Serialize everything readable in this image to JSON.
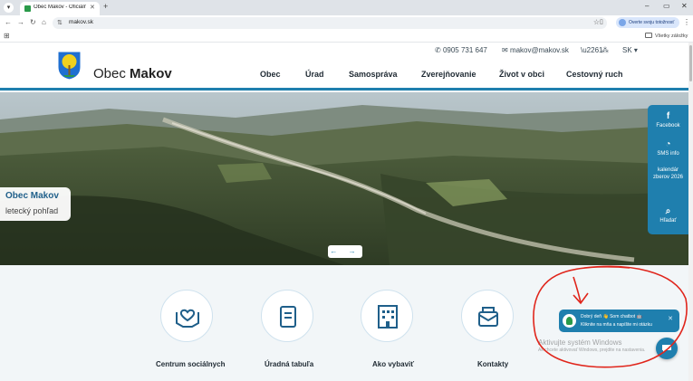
{
  "browser": {
    "tab_title": "Obec Makov - Oficiálna stránk",
    "tab_close": "✕",
    "new_tab": "+",
    "url": "makov.sk",
    "verify_label": "Overte svoju totožnosť",
    "all_bookmarks": "Všetky záložky",
    "window_minimize": "–",
    "window_maximize": "▭",
    "window_close": "✕"
  },
  "topbar": {
    "phone": "0905 731 647",
    "email": "makov@makov.sk",
    "language": "SK"
  },
  "header": {
    "brand_prefix": "Obec ",
    "brand_name": "Makov",
    "menu": [
      "Obec",
      "Úrad",
      "Samospráva",
      "Zverejňovanie",
      "Život v obci",
      "Cestovný ruch"
    ]
  },
  "hero": {
    "title": "Obec Makov",
    "subtitle": "letecký pohľad",
    "arrows": "← →"
  },
  "side_panel": [
    {
      "icon": "facebook-icon",
      "label": "Facebook"
    },
    {
      "icon": "sms-icon",
      "label": "SMS info"
    },
    {
      "icon": "calendar-icon",
      "label": "kalendár zberov 2026"
    },
    {
      "icon": "search-icon",
      "label": "Hľadať"
    }
  ],
  "services": [
    {
      "icon": "hands-heart-icon",
      "label": "Centrum sociálnych"
    },
    {
      "icon": "book-icon",
      "label": "Úradná tabuľa"
    },
    {
      "icon": "building-icon",
      "label": "Ako vybaviť"
    },
    {
      "icon": "contacts-icon",
      "label": "Kontakty"
    }
  ],
  "chatbot": {
    "line1": "Dobrý deň 👋 Som chatbot 🤖",
    "line2": "Kliknite na mňa a napíšte mi otázku",
    "close": "✕"
  },
  "watermark": {
    "line1": "Aktivujte systém Windows",
    "line2": "Ak chcete aktivovať Windows, prejdite na nastavenia."
  },
  "colors": {
    "accent": "#1f7fae",
    "annotation": "#e0251b"
  }
}
